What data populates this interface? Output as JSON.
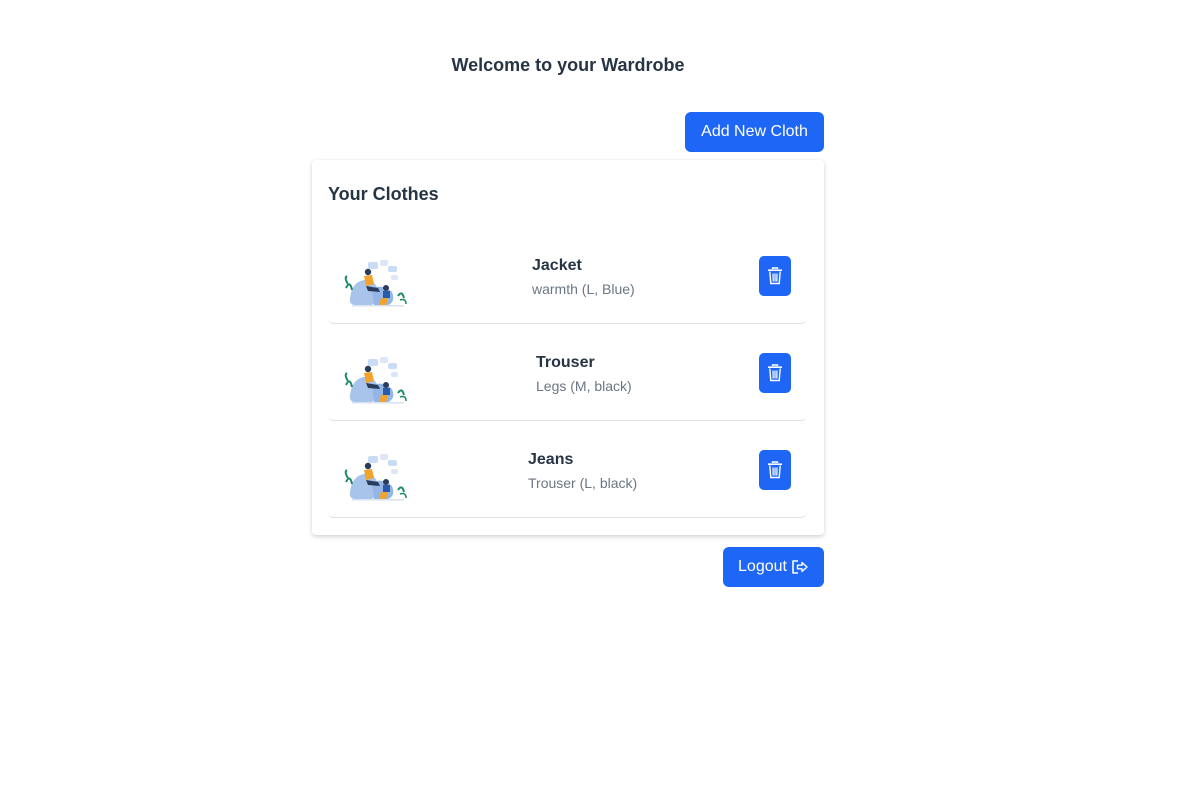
{
  "page": {
    "title": "Welcome to your Wardrobe"
  },
  "toolbar": {
    "add_label": "Add New Cloth"
  },
  "clothes": {
    "heading": "Your Clothes",
    "items": [
      {
        "name": "Jacket",
        "description": "warmth (L, Blue)",
        "thumbnail_icon": "wardrobe-illustration-icon",
        "action_icon": "trash-icon"
      },
      {
        "name": "Trouser",
        "description": "Legs (M, black)",
        "thumbnail_icon": "wardrobe-illustration-icon",
        "action_icon": "trash-icon"
      },
      {
        "name": "Jeans",
        "description": "Trouser (L, black)",
        "thumbnail_icon": "wardrobe-illustration-icon",
        "action_icon": "trash-icon"
      }
    ]
  },
  "footer": {
    "logout_label": "Logout",
    "logout_icon": "logout-icon"
  },
  "colors": {
    "primary": "#1e66f5",
    "heading_text": "#273444",
    "muted_text": "#6b7683"
  }
}
